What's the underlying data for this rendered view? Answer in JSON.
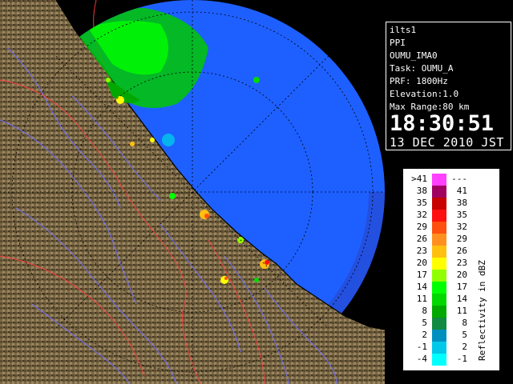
{
  "info": {
    "station": "ilts1",
    "product": "PPI",
    "site": "OUMU_IMA0",
    "task": "Task: OUMU_A",
    "prf": "PRF: 1800Hz",
    "elevation": "Elevation:1.0",
    "range": "Max Range:80 km",
    "time": "18:30:51",
    "date": "13 DEC 2010 JST"
  },
  "legend": {
    "title": "Reflectivity in dBZ",
    "rows": [
      {
        "low": ">41",
        "high": "---",
        "color": "#ff40ff"
      },
      {
        "low": "38",
        "high": "41",
        "color": "#a00060"
      },
      {
        "low": "35",
        "high": "38",
        "color": "#c80000"
      },
      {
        "low": "32",
        "high": "35",
        "color": "#ff1010"
      },
      {
        "low": "29",
        "high": "32",
        "color": "#ff5010"
      },
      {
        "low": "26",
        "high": "29",
        "color": "#ff9020"
      },
      {
        "low": "23",
        "high": "26",
        "color": "#ffc010"
      },
      {
        "low": "20",
        "high": "23",
        "color": "#ffff00"
      },
      {
        "low": "17",
        "high": "20",
        "color": "#90ff00"
      },
      {
        "low": "14",
        "high": "17",
        "color": "#00ff00"
      },
      {
        "low": "11",
        "high": "14",
        "color": "#00d800"
      },
      {
        "low": "8",
        "high": "11",
        "color": "#00a800"
      },
      {
        "low": "5",
        "high": "8",
        "color": "#108a40"
      },
      {
        "low": "2",
        "high": "5",
        "color": "#0090c0"
      },
      {
        "low": "-1",
        "high": "2",
        "color": "#00c8e8"
      },
      {
        "low": "-4",
        "high": "-1",
        "color": "#00ffff"
      }
    ]
  },
  "colors": {
    "sea": "#1e60ff",
    "land": "#7a6845",
    "range_ring": "#000000",
    "coast_line": "#000000",
    "river": "#7070ff",
    "boundary": "#ff4040"
  }
}
